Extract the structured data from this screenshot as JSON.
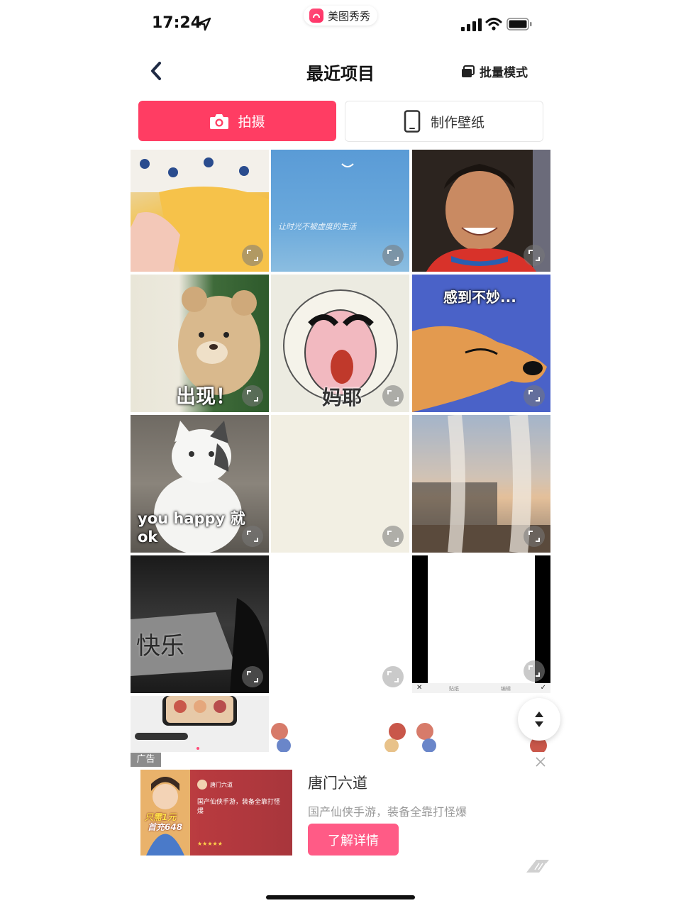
{
  "status_bar": {
    "time": "17:24",
    "app_name": "美图秀秀"
  },
  "nav": {
    "title": "最近项目",
    "batch_mode": "批量模式"
  },
  "actions": {
    "shoot": "拍摄",
    "make_wallpaper": "制作壁纸"
  },
  "grid": {
    "captions": {
      "bear": "出现！",
      "sheep": "妈耶",
      "dog": "感到不妙...",
      "cat": "you happy 就 ok",
      "sky_text": "让时光不被虚度的生活",
      "window_text": "快乐"
    },
    "toolbar": {
      "left": "贴纸",
      "right": "编辑"
    }
  },
  "ad": {
    "tag": "广告",
    "title": "唐门六道",
    "description": "国产仙侠手游，装备全靠打怪爆",
    "cta": "了解详情",
    "thumb": {
      "account": "唐门六道",
      "text": "国产仙侠手游，装备全靠打怪爆",
      "promo_line1": "只需1元",
      "promo_line2": "首充648",
      "rating": "★★★★★"
    }
  },
  "colors": {
    "accent": "#ff3d63",
    "cta": "#ff5b86"
  }
}
